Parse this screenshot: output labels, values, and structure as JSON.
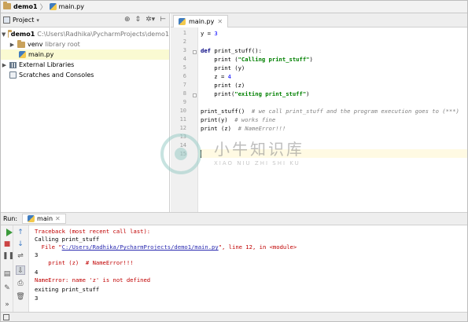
{
  "breadcrumb": {
    "project": "demo1",
    "file": "main.py"
  },
  "project_panel": {
    "title": "Project",
    "toolbar_icons": [
      "target-icon",
      "collapse-icon",
      "settings-icon",
      "hide-icon"
    ],
    "tree": {
      "root_name": "demo1",
      "root_path": "C:\\Users\\Radhika\\PycharmProjects\\demo1",
      "venv_name": "venv",
      "venv_tag": "library root",
      "file": "main.py",
      "external": "External Libraries",
      "scratches": "Scratches and Consoles"
    }
  },
  "editor": {
    "tab": "main.py",
    "line_numbers": [
      "1",
      "2",
      "3",
      "4",
      "5",
      "6",
      "7",
      "8",
      "9",
      "10",
      "11",
      "12",
      "13",
      "14",
      "15"
    ],
    "code": {
      "l1": {
        "a": "y = ",
        "b": "3"
      },
      "l3": {
        "kw": "def ",
        "rest": "print_stuff():"
      },
      "l4": {
        "a": "    print (",
        "s": "\"Calling print_stuff\"",
        "b": ")"
      },
      "l5": "    print (y)",
      "l6": {
        "a": "    z = ",
        "b": "4"
      },
      "l7": "    print (z)",
      "l8": {
        "a": "    print(",
        "s": "\"exiting print_stuff\"",
        "b": ")"
      },
      "l10": {
        "a": "print_stuff()  ",
        "c": "# we call print_stuff and the program execution goes to (***)"
      },
      "l11": {
        "a": "print(y)  ",
        "c": "# works fine"
      },
      "l12": {
        "a": "print (z)  ",
        "c": "# NameError!!!"
      }
    }
  },
  "watermark": {
    "title": "小牛知识库",
    "subtitle": "XIAO NIU ZHI SHI KU"
  },
  "run": {
    "label": "Run:",
    "tab": "main",
    "output": {
      "o1": "Traceback (most recent call last):",
      "o2": "Calling print_stuff",
      "o3a": "  File \"",
      "o3link": "C:/Users/Radhika/PycharmProjects/demo1/main.py",
      "o3b": "\", line 12, in <module>",
      "o4": "3",
      "o5": "    print (z)  # NameError!!!",
      "o6": "4",
      "o7": "NameError: name 'z' is not defined",
      "o8": "exiting print_stuff",
      "o9": "3"
    }
  }
}
